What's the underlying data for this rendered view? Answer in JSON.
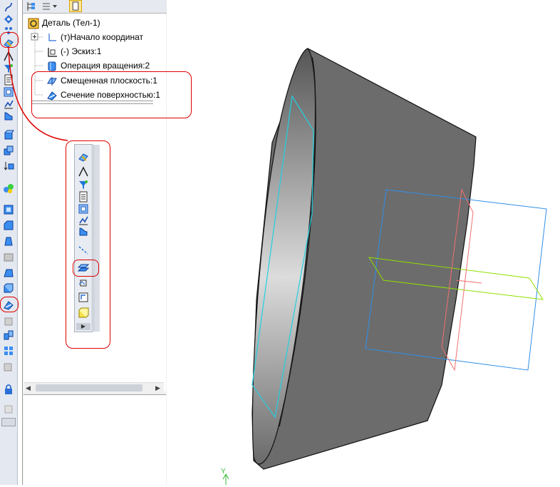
{
  "tree": {
    "root": "Деталь (Тел-1)",
    "items": [
      {
        "label": "(т)Начало координат",
        "icon": "origin-icon"
      },
      {
        "label": "(-) Эскиз:1",
        "icon": "sketch-icon"
      },
      {
        "label": "Операция вращения:2",
        "icon": "rotation-operation-icon"
      },
      {
        "label": "Смещенная плоскость:1",
        "icon": "offset-plane-icon"
      },
      {
        "label": "Сечение поверхностью:1",
        "icon": "surface-section-icon"
      }
    ]
  },
  "viewport": {
    "axis_label": "Y",
    "colors": {
      "body_dark": "#4d4d4d",
      "body_light": "#d8d8d8",
      "plane_blue": "#2e8fe8",
      "plane_green": "#8fe000",
      "plane_red": "#f07070",
      "edge_cyan": "#22d0e0",
      "callout_red": "#e00000"
    }
  }
}
